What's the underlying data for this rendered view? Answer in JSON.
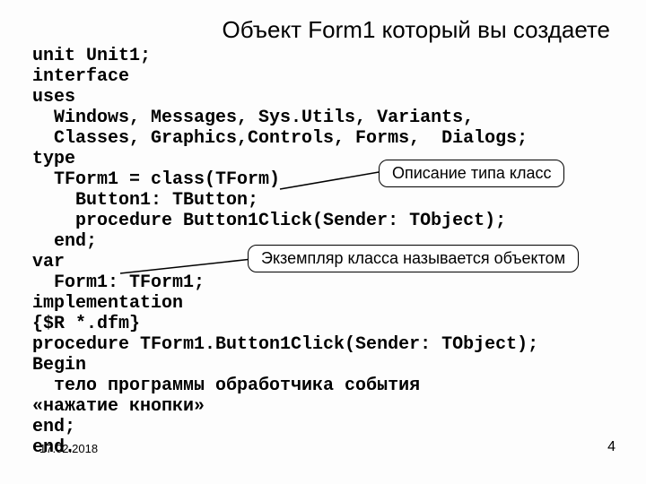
{
  "title": "Объект Form1 который вы создаете",
  "code_lines": [
    "unit Unit1;",
    "interface",
    "uses",
    "  Windows, Messages, Sys.Utils, Variants,",
    "  Classes, Graphics,Controls, Forms,  Dialogs;",
    "type",
    "  TForm1 = class(TForm)",
    "    Button1: TButton;",
    "    procedure Button1Click(Sender: TObject);",
    "  end;",
    "var",
    "  Form1: TForm1;",
    "implementation",
    "{$R *.dfm}",
    "procedure TForm1.Button1Click(Sender: TObject);",
    "Begin",
    "  тело программы обработчика события",
    "«нажатие кнопки»",
    "end;",
    "end."
  ],
  "callout1": "Описание типа класс",
  "callout2": "Экземпляр класса называется объектом",
  "date": "17.02.2018",
  "page": "4"
}
